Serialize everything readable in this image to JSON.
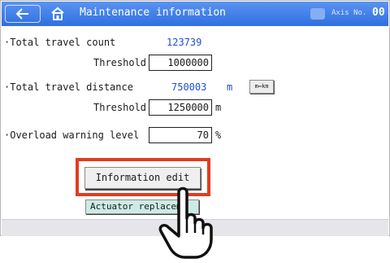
{
  "header": {
    "title": "Maintenance information",
    "axis_label": "Axis No.",
    "axis_value": "00"
  },
  "rows": {
    "travel_count": {
      "label": "·Total travel count",
      "value": "123739"
    },
    "travel_count_threshold": {
      "label": "Threshold",
      "value": "1000000"
    },
    "travel_distance": {
      "label": "·Total travel distance",
      "value": "750003",
      "unit": "m",
      "toggle_label": "m⇔km"
    },
    "travel_distance_threshold": {
      "label": "Threshold",
      "value": "1250000",
      "unit": "m"
    },
    "overload": {
      "label": "·Overload warning level",
      "value": "70",
      "unit": "%"
    }
  },
  "buttons": {
    "information_edit": "Information edit",
    "actuator_replacement": "Actuator replacem"
  },
  "colors": {
    "title_bar": "#2f6fe0",
    "value_blue": "#1f4fd1",
    "highlight_outline": "#e23c21",
    "actuator_button": "#cdebe6"
  },
  "icons": {
    "back": "left-arrow-icon",
    "home": "home-icon",
    "axis": "axis-icon",
    "pointer": "pointing-hand-icon"
  }
}
